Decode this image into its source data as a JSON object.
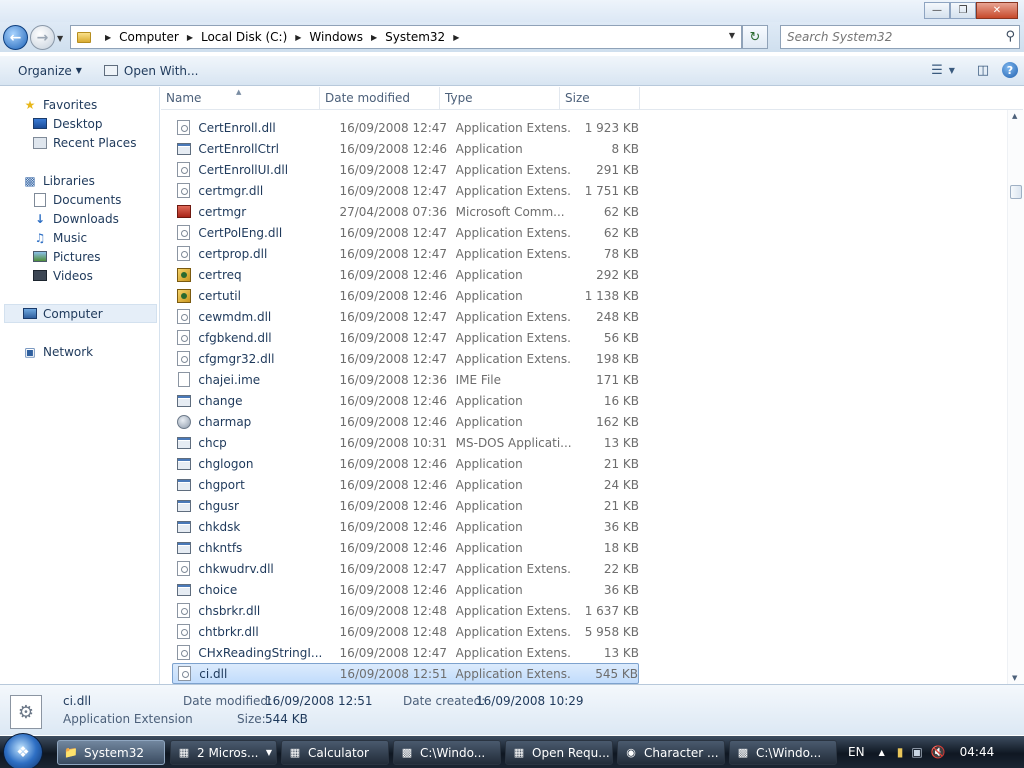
{
  "address": {
    "crumbs": [
      "Computer",
      "Local Disk (C:)",
      "Windows",
      "System32"
    ],
    "search_placeholder": "Search System32"
  },
  "toolbar": {
    "organize": "Organize",
    "open_with": "Open With..."
  },
  "nav": {
    "favorites": "Favorites",
    "desktop": "Desktop",
    "recent_places": "Recent Places",
    "libraries": "Libraries",
    "documents": "Documents",
    "downloads": "Downloads",
    "music": "Music",
    "pictures": "Pictures",
    "videos": "Videos",
    "computer": "Computer",
    "network": "Network"
  },
  "columns": {
    "name": "Name",
    "date": "Date modified",
    "type": "Type",
    "size": "Size"
  },
  "files": [
    {
      "name": "CertEnroll.dll",
      "date": "16/09/2008 12:47",
      "type": "Application Extens...",
      "size": "1 923 KB",
      "icon": "dll"
    },
    {
      "name": "CertEnrollCtrl",
      "date": "16/09/2008 12:46",
      "type": "Application",
      "size": "8 KB",
      "icon": "app"
    },
    {
      "name": "CertEnrollUI.dll",
      "date": "16/09/2008 12:47",
      "type": "Application Extens...",
      "size": "291 KB",
      "icon": "dll"
    },
    {
      "name": "certmgr.dll",
      "date": "16/09/2008 12:47",
      "type": "Application Extens...",
      "size": "1 751 KB",
      "icon": "dll"
    },
    {
      "name": "certmgr",
      "date": "27/04/2008 07:36",
      "type": "Microsoft Comm...",
      "size": "62 KB",
      "icon": "msc"
    },
    {
      "name": "CertPolEng.dll",
      "date": "16/09/2008 12:47",
      "type": "Application Extens...",
      "size": "62 KB",
      "icon": "dll"
    },
    {
      "name": "certprop.dll",
      "date": "16/09/2008 12:47",
      "type": "Application Extens...",
      "size": "78 KB",
      "icon": "dll"
    },
    {
      "name": "certreq",
      "date": "16/09/2008 12:46",
      "type": "Application",
      "size": "292 KB",
      "icon": "cert"
    },
    {
      "name": "certutil",
      "date": "16/09/2008 12:46",
      "type": "Application",
      "size": "1 138 KB",
      "icon": "cert"
    },
    {
      "name": "cewmdm.dll",
      "date": "16/09/2008 12:47",
      "type": "Application Extens...",
      "size": "248 KB",
      "icon": "dll"
    },
    {
      "name": "cfgbkend.dll",
      "date": "16/09/2008 12:47",
      "type": "Application Extens...",
      "size": "56 KB",
      "icon": "dll"
    },
    {
      "name": "cfgmgr32.dll",
      "date": "16/09/2008 12:47",
      "type": "Application Extens...",
      "size": "198 KB",
      "icon": "dll"
    },
    {
      "name": "chajei.ime",
      "date": "16/09/2008 12:36",
      "type": "IME File",
      "size": "171 KB",
      "icon": "file"
    },
    {
      "name": "change",
      "date": "16/09/2008 12:46",
      "type": "Application",
      "size": "16 KB",
      "icon": "app"
    },
    {
      "name": "charmap",
      "date": "16/09/2008 12:46",
      "type": "Application",
      "size": "162 KB",
      "icon": "charmap"
    },
    {
      "name": "chcp",
      "date": "16/09/2008 10:31",
      "type": "MS-DOS Applicati...",
      "size": "13 KB",
      "icon": "app"
    },
    {
      "name": "chglogon",
      "date": "16/09/2008 12:46",
      "type": "Application",
      "size": "21 KB",
      "icon": "app"
    },
    {
      "name": "chgport",
      "date": "16/09/2008 12:46",
      "type": "Application",
      "size": "24 KB",
      "icon": "app"
    },
    {
      "name": "chgusr",
      "date": "16/09/2008 12:46",
      "type": "Application",
      "size": "21 KB",
      "icon": "app"
    },
    {
      "name": "chkdsk",
      "date": "16/09/2008 12:46",
      "type": "Application",
      "size": "36 KB",
      "icon": "app"
    },
    {
      "name": "chkntfs",
      "date": "16/09/2008 12:46",
      "type": "Application",
      "size": "18 KB",
      "icon": "app"
    },
    {
      "name": "chkwudrv.dll",
      "date": "16/09/2008 12:47",
      "type": "Application Extens...",
      "size": "22 KB",
      "icon": "dll"
    },
    {
      "name": "choice",
      "date": "16/09/2008 12:46",
      "type": "Application",
      "size": "36 KB",
      "icon": "app"
    },
    {
      "name": "chsbrkr.dll",
      "date": "16/09/2008 12:48",
      "type": "Application Extens...",
      "size": "1 637 KB",
      "icon": "dll"
    },
    {
      "name": "chtbrkr.dll",
      "date": "16/09/2008 12:48",
      "type": "Application Extens...",
      "size": "5 958 KB",
      "icon": "dll"
    },
    {
      "name": "CHxReadingStringI...",
      "date": "16/09/2008 12:47",
      "type": "Application Extens...",
      "size": "13 KB",
      "icon": "dll"
    },
    {
      "name": "ci.dll",
      "date": "16/09/2008 12:51",
      "type": "Application Extens...",
      "size": "545 KB",
      "icon": "dll",
      "selected": true
    }
  ],
  "details": {
    "name": "ci.dll",
    "type": "Application Extension",
    "modified_label": "Date modified:",
    "modified_value": "16/09/2008 12:51",
    "created_label": "Date created:",
    "created_value": "16/09/2008 10:29",
    "size_label": "Size:",
    "size_value": "544 KB"
  },
  "taskbar": {
    "items": [
      {
        "label": "System32",
        "icon": "folder-icon",
        "active": true
      },
      {
        "label": "2 Micros...",
        "icon": "mmc-icon",
        "group": true
      },
      {
        "label": "Calculator",
        "icon": "calculator-icon"
      },
      {
        "label": "C:\\Windo...",
        "icon": "cmd-icon"
      },
      {
        "label": "Open Requ...",
        "icon": "cert-icon"
      },
      {
        "label": "Character ...",
        "icon": "charmap-icon"
      },
      {
        "label": "C:\\Windo...",
        "icon": "cmd-icon"
      }
    ],
    "lang": "EN",
    "time": "04:44"
  }
}
